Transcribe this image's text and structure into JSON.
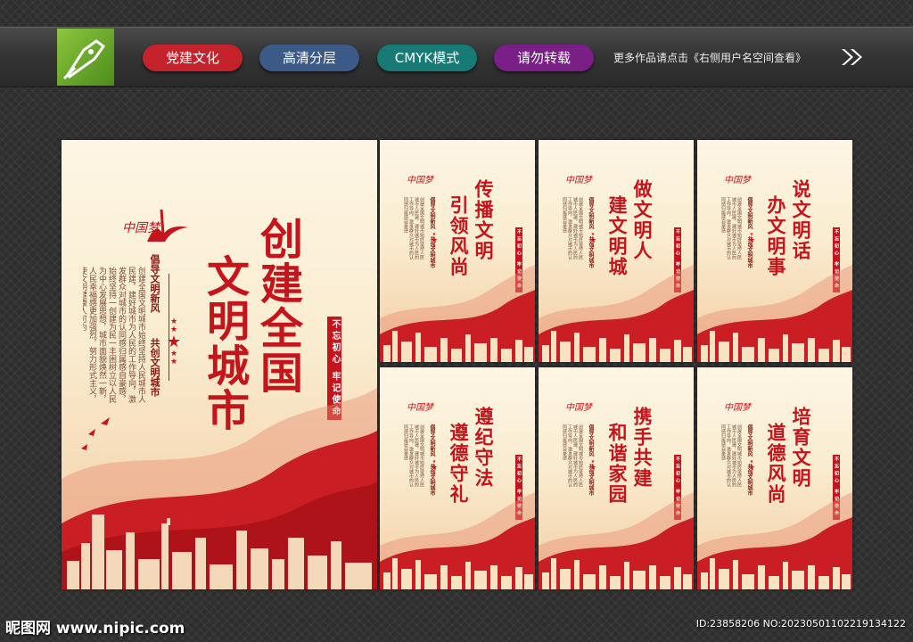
{
  "header": {
    "tags": [
      {
        "label": "党建文化",
        "color": "#c4232b"
      },
      {
        "label": "高清分层",
        "color": "#3c5a87"
      },
      {
        "label": "CMYK模式",
        "color": "#177a74"
      },
      {
        "label": "请勿转载",
        "color": "#7a1f86"
      }
    ],
    "note": "更多作品请点击《右侧用户名空间查看》",
    "logo_icon": "pen-nib-icon",
    "arrow_icon": "double-chevron-right-icon"
  },
  "main_poster": {
    "logo_text": "中国梦",
    "title_line1": "创建全国",
    "title_line2": "文明城市",
    "subtitle_a": "倡导文明新风",
    "subtitle_b": "共创文明城市",
    "body": "创建全国文明城市始终坚持人民城市人民建，建好城市为人民的工作导向，激发群众对城市的认同感归属感自豪感，始终坚持一创建为民一丰困树立以人民为中心发展思想，城市面貌焕然一新，人民幸福感更加强烈，努力形式主义，使文明健康人可为",
    "seal": "不忘初心 牢记使命"
  },
  "small_posters": [
    {
      "title": [
        "传播文明",
        "引领风尚"
      ]
    },
    {
      "title": [
        "做文明人",
        "建文明城"
      ]
    },
    {
      "title": [
        "说文明话",
        "办文明事"
      ]
    },
    {
      "title": [
        "遵纪守法",
        "遵德守礼"
      ]
    },
    {
      "title": [
        "携手共建",
        "和谐家园"
      ]
    },
    {
      "title": [
        "培育文明",
        "道德风尚"
      ]
    }
  ],
  "small_common": {
    "logo_text": "中国梦",
    "subtitle_a": "倡导文明新风",
    "subtitle_b": "共创文明城市",
    "body": "创建全国文明城市始终坚持人民城市人民建，建好城市为人民的工作导向，激发群众对城市的认同感归属感自豪感",
    "seal": "不忘初心 牢记使命"
  },
  "watermark": {
    "left": "昵图网 www.nipic.com",
    "right": "ID:23858206 NO:20230501102219134122"
  },
  "colors": {
    "accent_red": "#c4141c",
    "poster_bg": "#fdf6e4"
  }
}
